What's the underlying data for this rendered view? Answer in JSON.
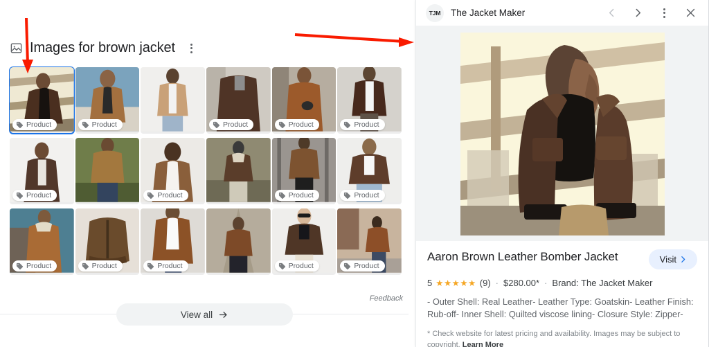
{
  "top_chips": [
    {
      "label": ""
    },
    {
      "label": ""
    },
    {
      "label": ""
    },
    {
      "label": ""
    },
    {
      "label": ""
    }
  ],
  "images_module": {
    "icon": "image-icon",
    "title": "Images for brown jacket",
    "overflow_icon": "kebab-menu-icon",
    "badge_label": "Product",
    "badge_icon": "tag-icon",
    "feedback_label": "Feedback",
    "view_all_label": "View all",
    "view_all_icon": "arrow-right-icon",
    "thumbnails": [
      {
        "id": 1,
        "selected": true,
        "badge": true,
        "alt": "man in dark brown leather jacket on rooftop"
      },
      {
        "id": 2,
        "selected": false,
        "badge": true,
        "alt": "man in tan leather jacket with scarf"
      },
      {
        "id": 3,
        "selected": false,
        "badge": false,
        "alt": "tan corduroy trucker jacket on model"
      },
      {
        "id": 4,
        "selected": false,
        "badge": true,
        "alt": "man in brown leather jacket on street"
      },
      {
        "id": 5,
        "selected": false,
        "badge": true,
        "alt": "bearded man in cognac leather jacket with gloves"
      },
      {
        "id": 6,
        "selected": false,
        "badge": true,
        "alt": "man in dark brown zip leather jacket"
      },
      {
        "id": 7,
        "selected": false,
        "badge": true,
        "alt": "woman in brown bomber jacket with glasses"
      },
      {
        "id": 8,
        "selected": false,
        "badge": false,
        "alt": "man in tan suede jacket outdoors"
      },
      {
        "id": 9,
        "selected": false,
        "badge": true,
        "alt": "man in brown suede shirt jacket"
      },
      {
        "id": 10,
        "selected": false,
        "badge": false,
        "alt": "man in shearling jacket holding helmet"
      },
      {
        "id": 11,
        "selected": false,
        "badge": true,
        "alt": "man in brown suede jacket by gate"
      },
      {
        "id": 12,
        "selected": false,
        "badge": true,
        "alt": "woman in oversized brown leather jacket"
      },
      {
        "id": 13,
        "selected": false,
        "badge": true,
        "alt": "man in aviator bomber with shearling collar"
      },
      {
        "id": 14,
        "selected": false,
        "badge": true,
        "alt": "brown suede bomber jacket flat lay"
      },
      {
        "id": 15,
        "selected": false,
        "badge": true,
        "alt": "man in brown suede jacket white shirt"
      },
      {
        "id": 16,
        "selected": false,
        "badge": false,
        "alt": "man in brown leather jacket by Eiffel Tower"
      },
      {
        "id": 17,
        "selected": false,
        "badge": true,
        "alt": "woman in brown leather jacket sunglasses"
      },
      {
        "id": 18,
        "selected": false,
        "badge": true,
        "alt": "man walking in brown leather jacket"
      }
    ]
  },
  "panel": {
    "avatar_text": "TJM",
    "avatar_name": "brand-avatar",
    "title": "The Jacket Maker",
    "nav": {
      "back_icon": "chevron-left-icon",
      "forward_icon": "chevron-right-icon",
      "overflow_icon": "kebab-menu-icon",
      "close_icon": "close-icon"
    },
    "hero_alt": "Aaron Brown Leather Bomber Jacket worn by model on rooftop",
    "product": {
      "name": "Aaron Brown Leather Bomber Jacket",
      "visit_label": "Visit",
      "visit_icon": "chevron-right-icon",
      "rating_value": "5",
      "stars": "★★★★★",
      "review_count": "(9)",
      "price": "$280.00*",
      "brand": "Brand: The Jacket Maker",
      "separator": "·",
      "description": "- Outer Shell: Real Leather- Leather Type: Goatskin- Leather Finish: Rub-off- Inner Shell: Quilted viscose lining- Closure Style: Zipper- Collar ...",
      "disclaimer": "* Check website for latest pricing and availability. Images may be subject to copyright.",
      "learn_more": "Learn More"
    }
  },
  "annotations": {
    "arrow_color": "#f91b00",
    "down_arrow_name": "red-down-arrow-annotation",
    "right_arrow_name": "red-right-arrow-annotation"
  },
  "colors": {
    "accent_blue": "#1a73e8",
    "star_gold": "#f5a623",
    "panel_bg": "#f1f3f4",
    "text_primary": "#202124",
    "text_secondary": "#5f6368"
  }
}
